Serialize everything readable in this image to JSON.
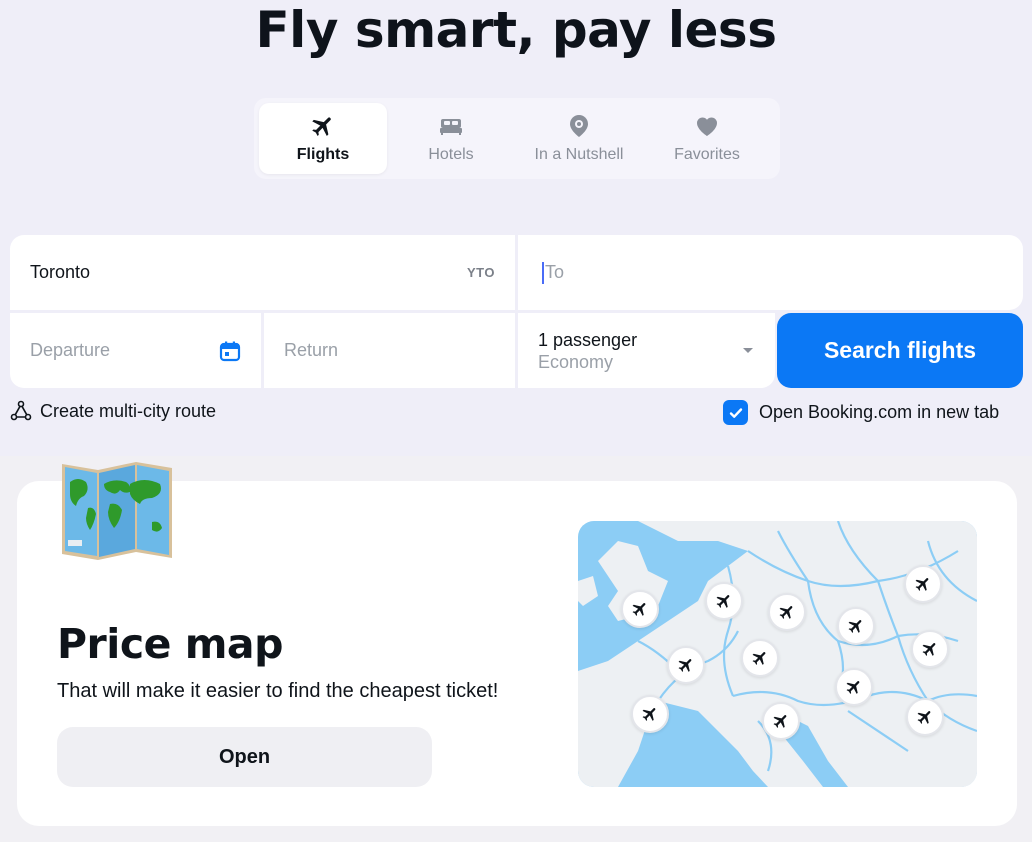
{
  "hero": {
    "title": "Fly smart, pay less"
  },
  "tabs": [
    {
      "label": "Flights",
      "icon": "plane-icon",
      "active": true
    },
    {
      "label": "Hotels",
      "icon": "bed-icon",
      "active": false
    },
    {
      "label": "In a Nutshell",
      "icon": "location-pin-icon",
      "active": false
    },
    {
      "label": "Favorites",
      "icon": "heart-icon",
      "active": false
    }
  ],
  "search": {
    "from_value": "Toronto",
    "from_code": "YTO",
    "to_placeholder": "To",
    "departure_placeholder": "Departure",
    "return_placeholder": "Return",
    "passengers": "1 passenger",
    "cabin_class": "Economy",
    "search_button": "Search flights",
    "multi_city_label": "Create multi-city route",
    "new_tab_label": "Open Booking.com in new tab",
    "new_tab_checked": true
  },
  "price_map": {
    "title": "Price map",
    "subtitle": "That will make it easier to find the cheapest ticket!",
    "button": "Open"
  },
  "colors": {
    "accent": "#0b78f5",
    "page_bg": "#efeef8",
    "map_water": "#8ccdf5",
    "map_land": "#edf0f3"
  }
}
